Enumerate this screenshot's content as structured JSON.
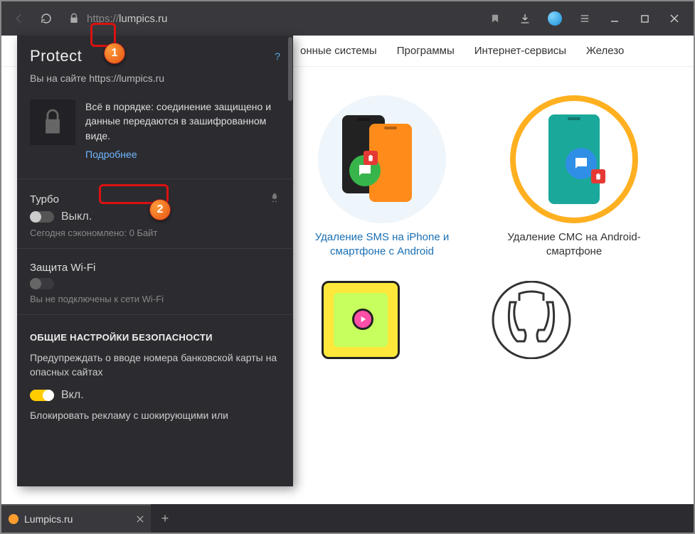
{
  "toolbar": {
    "url_proto": "https://",
    "url_host": "lumpics.ru"
  },
  "site_nav": {
    "item1": "онные системы",
    "item2": "Программы",
    "item3": "Интернет-сервисы",
    "item4": "Железо"
  },
  "protect": {
    "title": "Protect",
    "help": "?",
    "site_line": "Вы на сайте https://lumpics.ru",
    "sec_text": "Всё в порядке: соединение защищено и данные передаются в зашифрованном виде.",
    "details": "Подробнее",
    "turbo": {
      "title": "Турбо",
      "state": "Выкл.",
      "sub": "Сегодня сэкономлено: 0 Байт"
    },
    "wifi": {
      "title": "Защита Wi-Fi",
      "sub": "Вы не подключены к сети Wi-Fi"
    },
    "section_h": "ОБЩИЕ НАСТРОЙКИ БЕЗОПАСНОСТИ",
    "setting1": {
      "text": "Предупреждать о вводе номера банковской карты на опасных сайтах",
      "state": "Вкл."
    },
    "setting2": {
      "text": "Блокировать рекламу с шокирующими или"
    }
  },
  "cards": {
    "c1": "Удаление SMS на iPhone и смартфоне с Android",
    "c2": "Удаление СМС на Android-смартфоне"
  },
  "tab": {
    "title": "Lumpics.ru"
  },
  "callouts": {
    "n1": "1",
    "n2": "2"
  }
}
